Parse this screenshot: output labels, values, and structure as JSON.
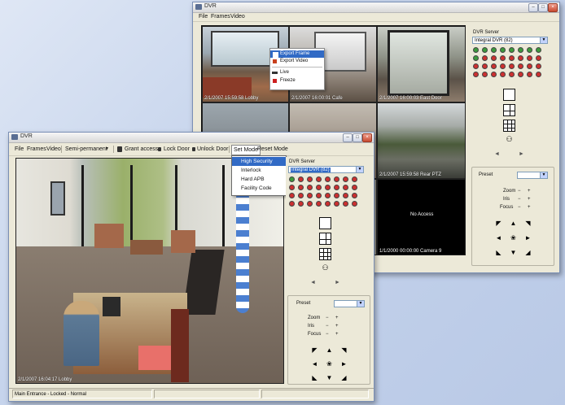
{
  "back_window": {
    "title": "DVR",
    "menu": [
      "File",
      "Frames",
      "Video"
    ],
    "cameras": [
      {
        "stamp": "2/1/2007  15:59:58 Lobby"
      },
      {
        "stamp": "2/1/2007  16:00:01 Cafe"
      },
      {
        "stamp": "2/1/2007  16:00:03 East Door"
      },
      {
        "stamp": ""
      },
      {
        "stamp": ""
      },
      {
        "stamp": "2/1/2007  15:59:58 Rear PTZ"
      },
      {
        "stamp": ""
      },
      {
        "stamp": ""
      },
      {
        "stamp": "1/1/2000  00:00:00 Camera 9"
      }
    ],
    "no_access": "No Access",
    "context_menu": [
      "Export Frame",
      "Export Video",
      "Live",
      "Freeze"
    ],
    "server_label": "DVR Server",
    "server_value": "Integral DVR (82)",
    "preset_label": "Preset",
    "zoom_label": "Zoom",
    "iris_label": "Iris",
    "focus_label": "Focus",
    "minus": "−",
    "plus": "+"
  },
  "front_window": {
    "title": "DVR",
    "menu": [
      "File",
      "Frames",
      "Video"
    ],
    "toolbar": {
      "mode_select": "Semi-permanent",
      "grant_access": "Grant access",
      "lock_door": "Lock Door",
      "unlock_door": "Unlock Door",
      "set_mode": "Set Mode",
      "reset_mode": "Reset Mode"
    },
    "mode_dropdown": [
      "High Security",
      "Interlock",
      "Hard APB",
      "Facility Code"
    ],
    "camera_stamp": "2/1/2007  16:04:17 Lobby",
    "server_label": "DVR Server",
    "server_value": "Integral DVR (82)",
    "preset_label": "Preset",
    "zoom_label": "Zoom",
    "iris_label": "Iris",
    "focus_label": "Focus",
    "minus": "−",
    "plus": "+",
    "status": "Main Entrance - Locked - Normal"
  },
  "icons": {
    "minimize": "–",
    "maximize": "□",
    "close": "×",
    "dropdown": "▼",
    "left": "◄",
    "right": "►",
    "center": "❀",
    "up": "▲",
    "down": "▼",
    "ul": "◤",
    "ur": "◥",
    "dl": "◣",
    "dr": "◢",
    "binoculars": "⚇"
  },
  "colors": {
    "highlight": "#316ac5",
    "green_cam": "#3c9a3c",
    "red_cam": "#cc3030"
  }
}
